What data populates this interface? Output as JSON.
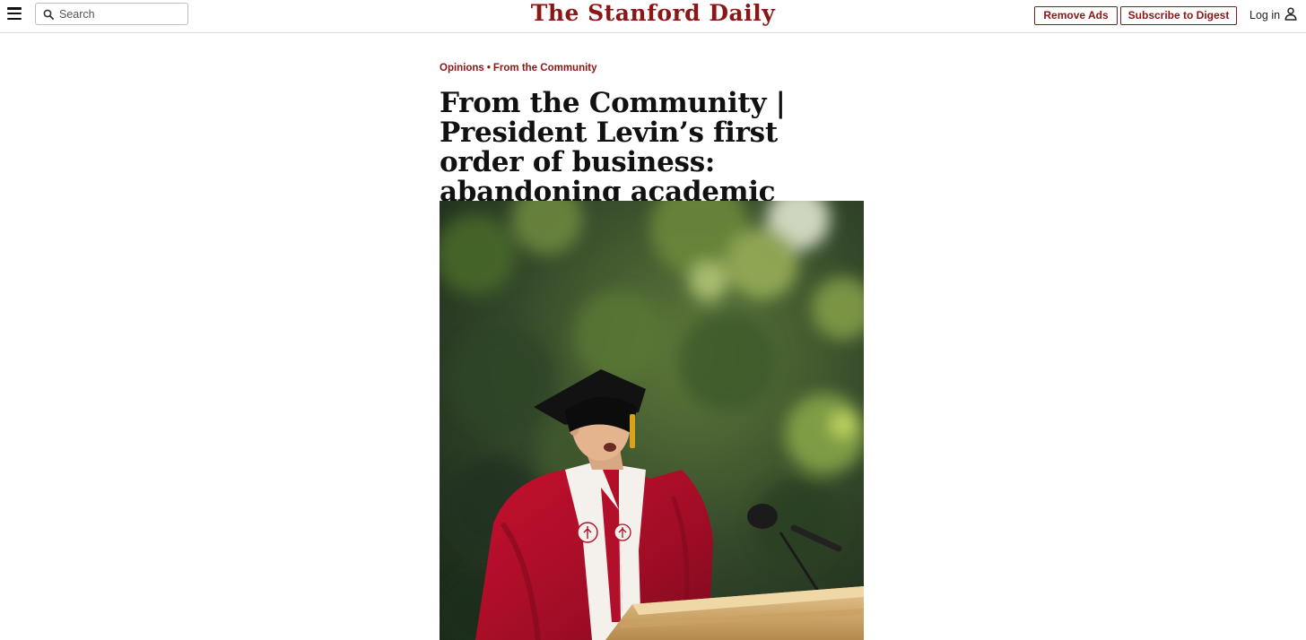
{
  "header": {
    "masthead": "The Stanford Daily",
    "search_placeholder": "Search",
    "remove_ads_label": "Remove Ads",
    "subscribe_label": "Subscribe to Digest",
    "login_label": "Log in",
    "icons": [
      "menu-icon",
      "search-icon",
      "user-icon"
    ]
  },
  "article": {
    "breadcrumb": {
      "section": "Opinions",
      "separator": "•",
      "subsection": "From the Community"
    },
    "headline": "From the Community | President Levin’s first order of business: abandoning academic freedom"
  },
  "theme": {
    "accent": "#8c1515",
    "text": "#111111",
    "divider": "#d9d9d9"
  }
}
